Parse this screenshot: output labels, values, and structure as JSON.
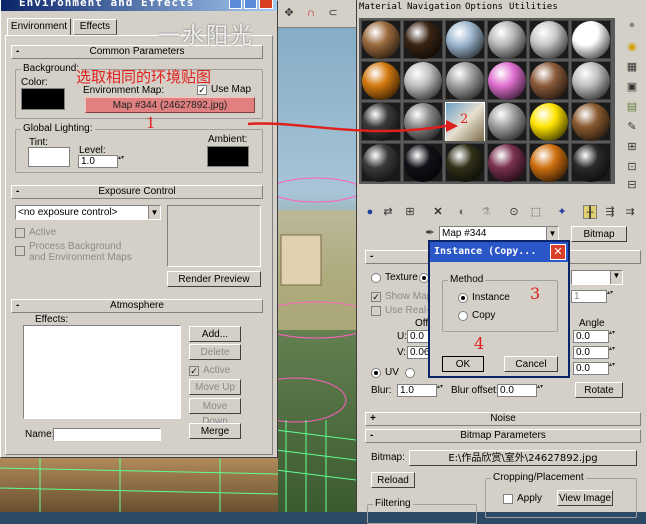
{
  "env_window": {
    "title": "Environment and Effects",
    "tabs": [
      "Environment",
      "Effects"
    ],
    "common": {
      "header": "Common Parameters",
      "background_label": "Background:",
      "color_label": "Color:",
      "env_map_label": "Environment Map:",
      "use_map_label": "Use Map",
      "map_button": "Map #344 (24627892.jpg)",
      "background_color": "#000000",
      "global_lighting_label": "Global Lighting:",
      "tint_label": "Tint:",
      "tint_color": "#ffffff",
      "level_label": "Level:",
      "level_value": "1.0",
      "ambient_label": "Ambient:",
      "ambient_color": "#000000"
    },
    "exposure": {
      "header": "Exposure Control",
      "select_value": "<no exposure control>",
      "active_label": "Active",
      "process_bg_label": "Process Background and Environment Maps",
      "render_preview": "Render Preview"
    },
    "atmosphere": {
      "header": "Atmosphere",
      "effects_label": "Effects:",
      "add": "Add...",
      "delete": "Delete",
      "active_label": "Active",
      "move_up": "Move Up",
      "move_down": "Move Down",
      "name_label": "Name:",
      "merge": "Merge"
    }
  },
  "material_editor": {
    "menu": [
      "Material",
      "Navigation",
      "Options",
      "Utilities"
    ],
    "spheres": [
      [
        "#9a6a3e",
        "#3a2414",
        "#9fb8d0",
        "#b8b8b8",
        "#c8c8c8",
        "#ffffff"
      ],
      [
        "#d47a10",
        "#c0c0c0",
        "#a0a0a0",
        "#e070d0",
        "#8a5a3a",
        "#bfbfbf"
      ],
      [
        "#3a3a3a",
        "#888888",
        "#6aa0c0",
        "#a0a0a0",
        "#ffe400",
        "#8a5a30"
      ],
      [
        "#3a3a3a",
        "#101018",
        "#303018",
        "#7a3050",
        "#d07010",
        "#2a2a2a"
      ]
    ],
    "map_name": "Map #344",
    "map_type": "Bitmap",
    "texture_label": "Texture",
    "show_map_label": "Show Map",
    "use_real_label": "Use Real-W",
    "offset_label": "Offs",
    "u_label": "U:",
    "u_value": "0.0",
    "v_label": "V:",
    "v_value": "0.06",
    "angle_label": "Angle",
    "angle_values": [
      "0.0",
      "0.0",
      "0.0"
    ],
    "right_spin": "1",
    "uv_label": "UV",
    "blur_label": "Blur:",
    "blur_value": "1.0",
    "blur_offset_label": "Blur offset:",
    "blur_offset_value": "0.0",
    "rotate": "Rotate",
    "noise_header": "Noise",
    "bitmap_header": "Bitmap Parameters",
    "bitmap_label": "Bitmap:",
    "bitmap_path": "E:\\作品欣赏\\室外\\24627892.jpg",
    "reload": "Reload",
    "cropping_label": "Cropping/Placement",
    "apply": "Apply",
    "view_image": "View Image",
    "filtering_label": "Filtering"
  },
  "instance_dialog": {
    "title": "Instance (Copy...",
    "method_label": "Method",
    "instance": "Instance",
    "copy": "Copy",
    "ok": "OK",
    "cancel": "Cancel"
  },
  "annotations": {
    "watermark": "一水阳光",
    "instruction": "选取相同的环境贴图",
    "n1": "1",
    "n2": "2",
    "n3": "3",
    "n4": "4"
  }
}
